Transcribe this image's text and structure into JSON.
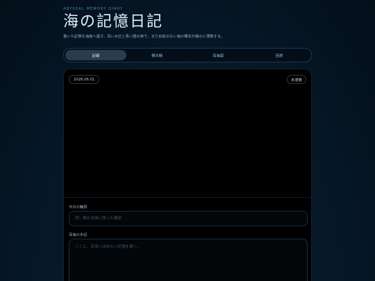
{
  "header": {
    "eyebrow": "ABYSSAL MEMORY DIARY",
    "title": "海の記憶日記",
    "subtitle": "書いた記憶を海底へ還す。深い水圧と青い闇の奥で、まだ名前のない海の標本が静かに漂着する。"
  },
  "tabs": [
    {
      "label": "記録",
      "active": true
    },
    {
      "label": "標本棚",
      "active": false
    },
    {
      "label": "深海図",
      "active": false
    },
    {
      "label": "回想",
      "active": false
    }
  ],
  "entry": {
    "date": "2026.06.01",
    "status": "未潜着",
    "title_label": "今日の輪郭",
    "title_placeholder": "例：朝の水面に残った輪郭",
    "note_label": "深海の手記",
    "note_placeholder": "ここに、深海へ沈めたい記憶を書く。"
  }
}
